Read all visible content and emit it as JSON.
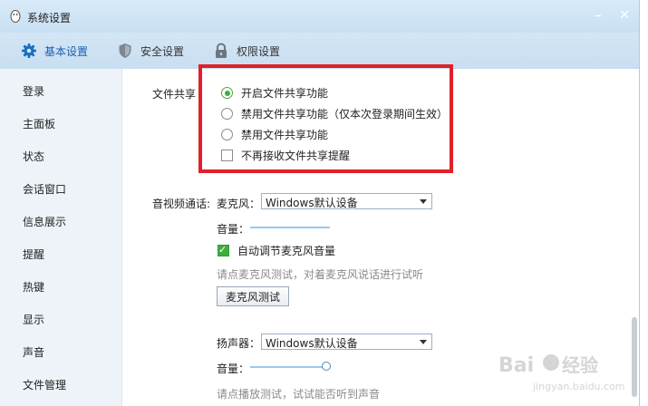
{
  "window": {
    "title": "系统设置",
    "minimize_glyph": "–",
    "close_glyph": "✕"
  },
  "tabs": [
    {
      "label": "基本设置",
      "icon": "gear-icon",
      "active": true
    },
    {
      "label": "安全设置",
      "icon": "shield-icon",
      "active": false
    },
    {
      "label": "权限设置",
      "icon": "lock-icon",
      "active": false
    }
  ],
  "sidebar": {
    "items": [
      {
        "label": "登录"
      },
      {
        "label": "主面板"
      },
      {
        "label": "状态"
      },
      {
        "label": "会话窗口"
      },
      {
        "label": "信息展示"
      },
      {
        "label": "提醒"
      },
      {
        "label": "热键"
      },
      {
        "label": "显示"
      },
      {
        "label": "声音"
      },
      {
        "label": "文件管理"
      }
    ]
  },
  "file_share": {
    "section_label": "文件共享",
    "options": [
      {
        "label": "开启文件共享功能",
        "checked": true
      },
      {
        "label": "禁用文件共享功能（仅本次登录期间生效）",
        "checked": false
      },
      {
        "label": "禁用文件共享功能",
        "checked": false
      }
    ],
    "no_reminder": {
      "label": "不再接收文件共享提醒",
      "checked": false
    }
  },
  "av_call": {
    "section_label": "音视频通话:",
    "microphone": {
      "label": "麦克风：",
      "device": "Windows默认设备",
      "volume_label": "音量：",
      "volume_level": 0.0,
      "auto_adjust": {
        "label": "自动调节麦克风音量",
        "checked": true
      },
      "hint": "请点麦克风测试，对着麦克风说话进行试听",
      "test_button": "麦克风测试"
    },
    "speaker": {
      "label": "扬声器：",
      "device": "Windows默认设备",
      "volume_label": "音量：",
      "volume_level": 1.0,
      "hint": "请点播放测试，试试能否听到声音"
    }
  },
  "colors": {
    "highlight_box": "#e0202a",
    "active_tab": "#1a5fb0",
    "check_green": "#3fae3f"
  }
}
